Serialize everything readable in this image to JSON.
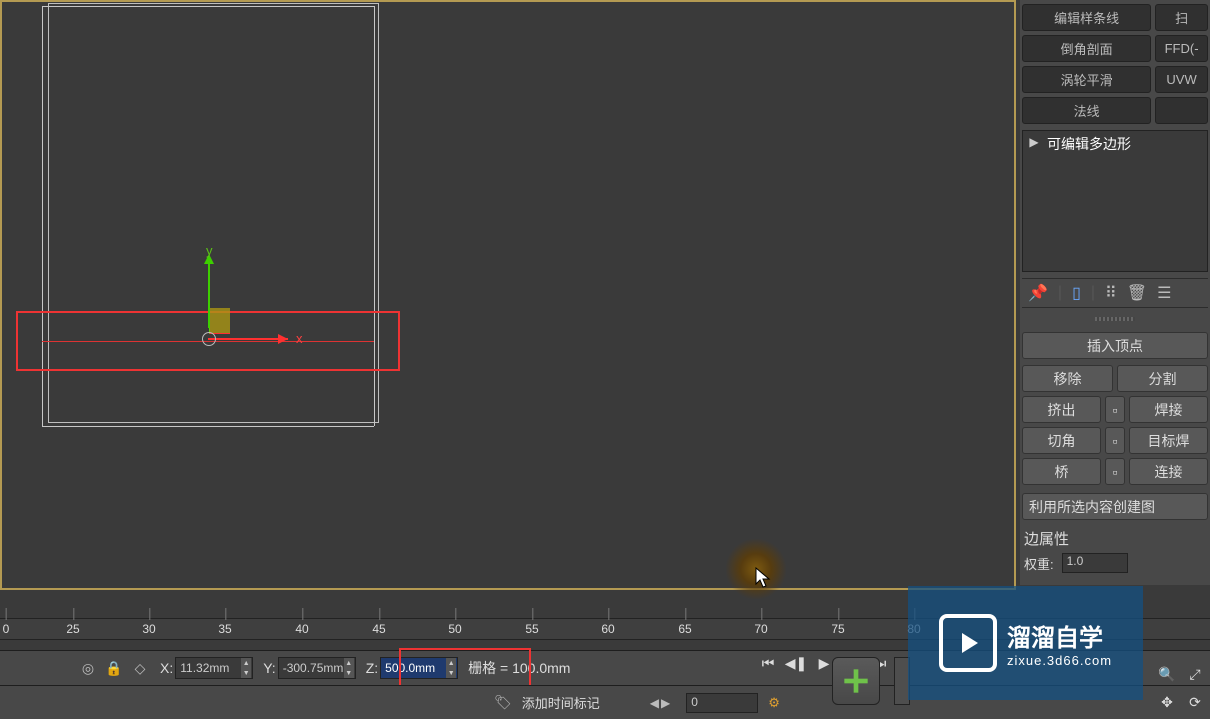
{
  "gizmo": {
    "y_label": "y",
    "x_label": "x"
  },
  "modifier_rows": [
    {
      "a": "编辑样条线",
      "b": "扫"
    },
    {
      "a": "倒角剖面",
      "b": "FFD(-"
    },
    {
      "a": "涡轮平滑",
      "b": "UVW"
    },
    {
      "a": "法线",
      "b": ""
    }
  ],
  "modifier_stack": {
    "entry": "可编辑多边形"
  },
  "rollout": {
    "insert_vertex": "插入顶点",
    "rows": [
      {
        "a": "移除",
        "sq": false,
        "b": "分割"
      },
      {
        "a": "挤出",
        "sq": true,
        "b": "焊接"
      },
      {
        "a": "切角",
        "sq": true,
        "b": "目标焊"
      },
      {
        "a": "桥",
        "sq": true,
        "b": "连接"
      }
    ],
    "use_sel": "利用所选内容创建图",
    "edge_props": "边属性",
    "weight_label": "权重:",
    "weight_value": "1.0"
  },
  "timeline": {
    "ticks": [
      "0",
      "25",
      "30",
      "35",
      "40",
      "45",
      "50",
      "55",
      "60",
      "65",
      "70",
      "75",
      "80"
    ]
  },
  "coords": {
    "x_label": "X:",
    "x": "11.32mm",
    "y_label": "Y:",
    "y": "-300.75mm",
    "z_label": "Z:",
    "z": "500.0mm",
    "grid": "栅格 = 100.0mm"
  },
  "status2": {
    "add_time_tag": "添加时间标记",
    "frame": "0"
  },
  "watermark": {
    "line1": "溜溜自学",
    "line2": "zixue.3d66.com"
  }
}
